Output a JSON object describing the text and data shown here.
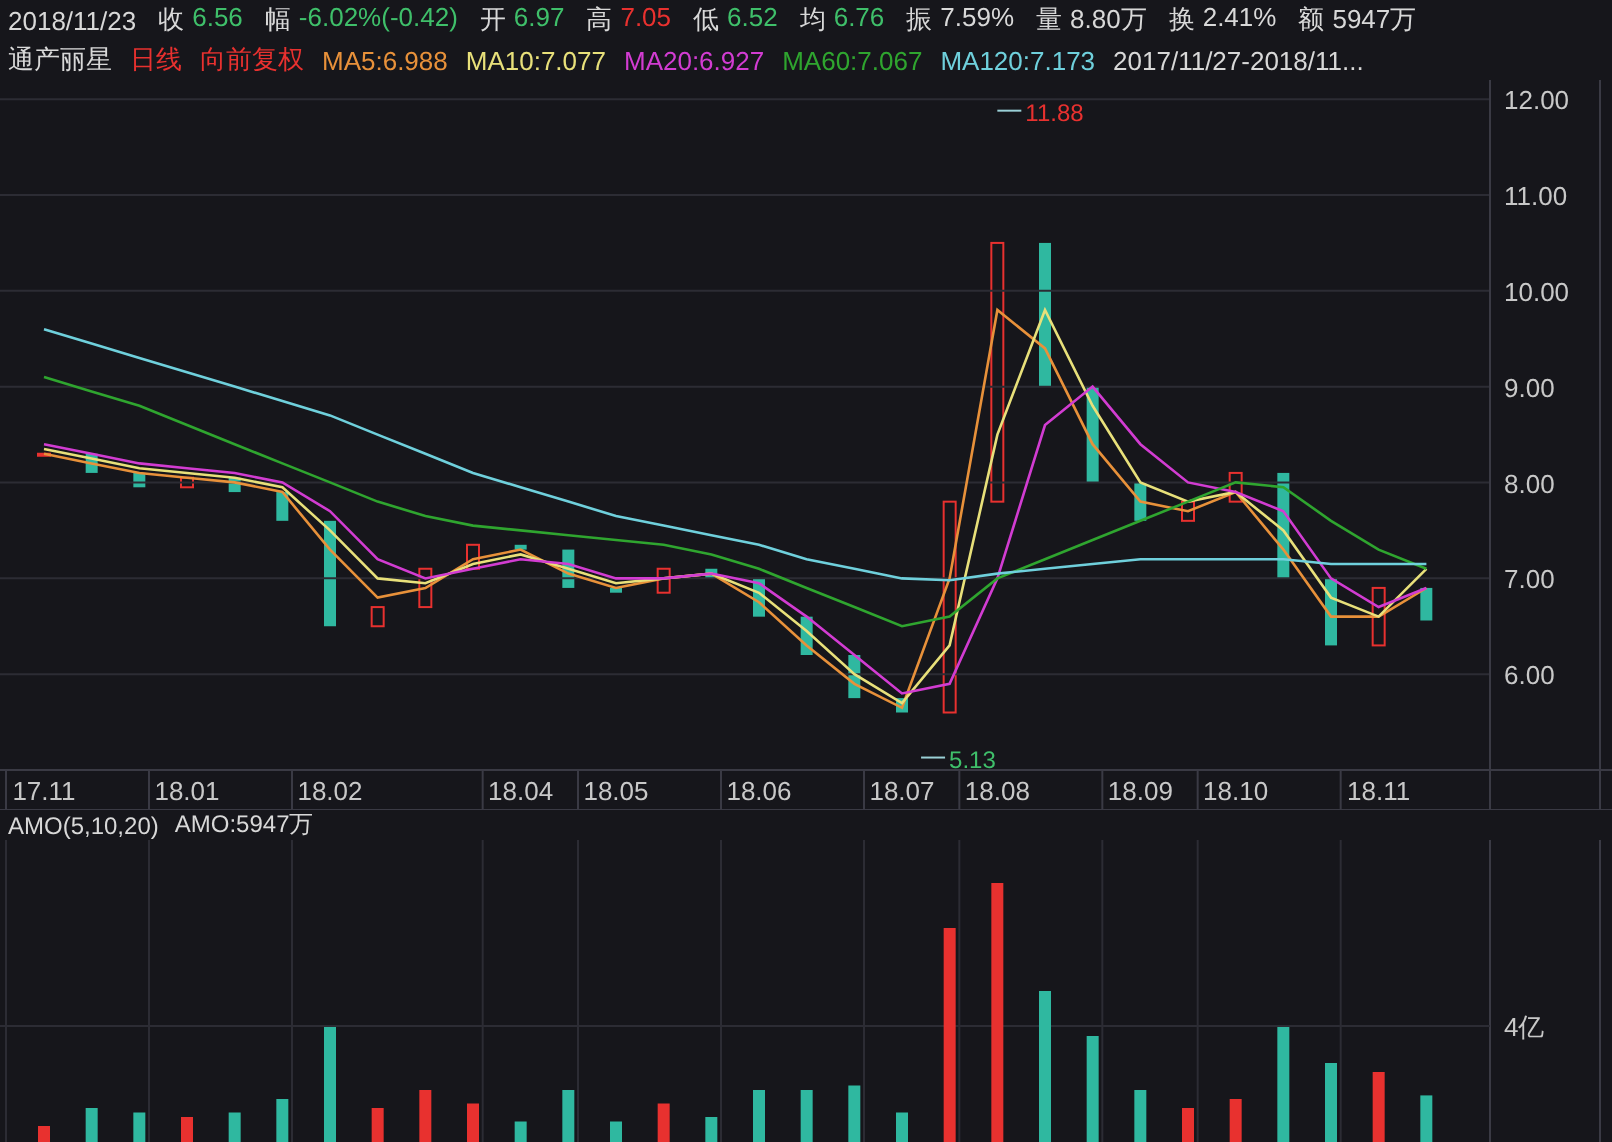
{
  "quote_bar": {
    "date": "2018/11/23",
    "fields": [
      {
        "label": "收",
        "value": "6.56",
        "color": "#3fbf6a"
      },
      {
        "label": "幅",
        "value": "-6.02%(-0.42)",
        "color": "#3fbf6a"
      },
      {
        "label": "开",
        "value": "6.97",
        "color": "#3fbf6a"
      },
      {
        "label": "高",
        "value": "7.05",
        "color": "#e8312f"
      },
      {
        "label": "低",
        "value": "6.52",
        "color": "#3fbf6a"
      },
      {
        "label": "均",
        "value": "6.76",
        "color": "#3fbf6a"
      },
      {
        "label": "振",
        "value": "7.59%",
        "color": "#d8d8d8"
      },
      {
        "label": "量",
        "value": "8.80万",
        "color": "#d8d8d8"
      },
      {
        "label": "换",
        "value": "2.41%",
        "color": "#d8d8d8"
      },
      {
        "label": "额",
        "value": "5947万",
        "color": "#d8d8d8"
      }
    ]
  },
  "chart_header": {
    "stock_name": "通产丽星",
    "period": "日线",
    "adjustment": "向前复权",
    "legend": [
      {
        "reading": ":6.988"
      },
      {
        "reading": ":7.077"
      },
      {
        "reading": ":6.927"
      },
      {
        "reading": ":7.067"
      },
      {
        "reading": ":7.173"
      }
    ],
    "date_range": "2017/11/27-2018/11..."
  },
  "price_chart": {
    "chart_data": {
      "type": "line",
      "categories": [
        "17.11",
        null,
        null,
        "18.01",
        null,
        null,
        "18.02",
        null,
        null,
        null,
        "18.04",
        null,
        "18.05",
        null,
        null,
        "18.06",
        null,
        null,
        "18.07",
        null,
        "18.08",
        null,
        null,
        "18.09",
        null,
        "18.10",
        null,
        null,
        "18.11",
        null
      ],
      "ylim": [
        5,
        12.2
      ],
      "grid": true,
      "yticks": [
        {
          "value": 6,
          "label": "6.00"
        },
        {
          "value": 7,
          "label": "7.00"
        },
        {
          "value": 8,
          "label": "8.00"
        },
        {
          "value": 9,
          "label": "9.00"
        },
        {
          "value": 10,
          "label": "10.00"
        },
        {
          "value": 11,
          "label": "11.00"
        },
        {
          "value": 12,
          "label": "12.00"
        }
      ],
      "series": [
        {
          "name": "MA5",
          "color": "#e8913a",
          "values": [
            8.3,
            8.2,
            8.1,
            8.05,
            8.0,
            7.9,
            7.3,
            6.8,
            6.9,
            7.2,
            7.3,
            7.05,
            6.9,
            7.0,
            7.05,
            6.75,
            6.3,
            5.9,
            5.65,
            7.0,
            9.8,
            9.4,
            8.4,
            7.8,
            7.7,
            7.9,
            7.3,
            6.6,
            6.6,
            6.9
          ]
        },
        {
          "name": "MA10",
          "color": "#e8e07a",
          "values": [
            8.35,
            8.25,
            8.15,
            8.1,
            8.05,
            7.95,
            7.5,
            7.0,
            6.95,
            7.15,
            7.25,
            7.1,
            6.95,
            7.0,
            7.05,
            6.85,
            6.45,
            6.0,
            5.7,
            6.3,
            8.5,
            9.8,
            8.8,
            8.0,
            7.8,
            7.9,
            7.5,
            6.8,
            6.6,
            7.1
          ]
        },
        {
          "name": "MA20",
          "color": "#d23cd2",
          "values": [
            8.4,
            8.3,
            8.2,
            8.15,
            8.1,
            8.0,
            7.7,
            7.2,
            7.0,
            7.1,
            7.2,
            7.15,
            7.0,
            7.0,
            7.05,
            6.95,
            6.6,
            6.2,
            5.8,
            5.9,
            7.0,
            8.6,
            9.0,
            8.4,
            8.0,
            7.9,
            7.7,
            7.0,
            6.7,
            6.9
          ]
        },
        {
          "name": "MA60",
          "color": "#2fa52f",
          "values": [
            9.1,
            8.95,
            8.8,
            8.6,
            8.4,
            8.2,
            8.0,
            7.8,
            7.65,
            7.55,
            7.5,
            7.45,
            7.4,
            7.35,
            7.25,
            7.1,
            6.9,
            6.7,
            6.5,
            6.6,
            7.0,
            7.2,
            7.4,
            7.6,
            7.8,
            8.0,
            7.95,
            7.6,
            7.3,
            7.1
          ]
        },
        {
          "name": "MA120",
          "color": "#6fd0dc",
          "values": [
            9.6,
            9.45,
            9.3,
            9.15,
            9.0,
            8.85,
            8.7,
            8.5,
            8.3,
            8.1,
            7.95,
            7.8,
            7.65,
            7.55,
            7.45,
            7.35,
            7.2,
            7.1,
            7.0,
            6.98,
            7.05,
            7.1,
            7.15,
            7.2,
            7.2,
            7.2,
            7.2,
            7.15,
            7.15,
            7.15
          ]
        }
      ],
      "annotations": [
        "11.88",
        "5.13"
      ]
    }
  },
  "volume_panel": {
    "indicator": "AMO(5,10,20)",
    "reading": "AMO:5947万",
    "y_tick": "4亿"
  }
}
